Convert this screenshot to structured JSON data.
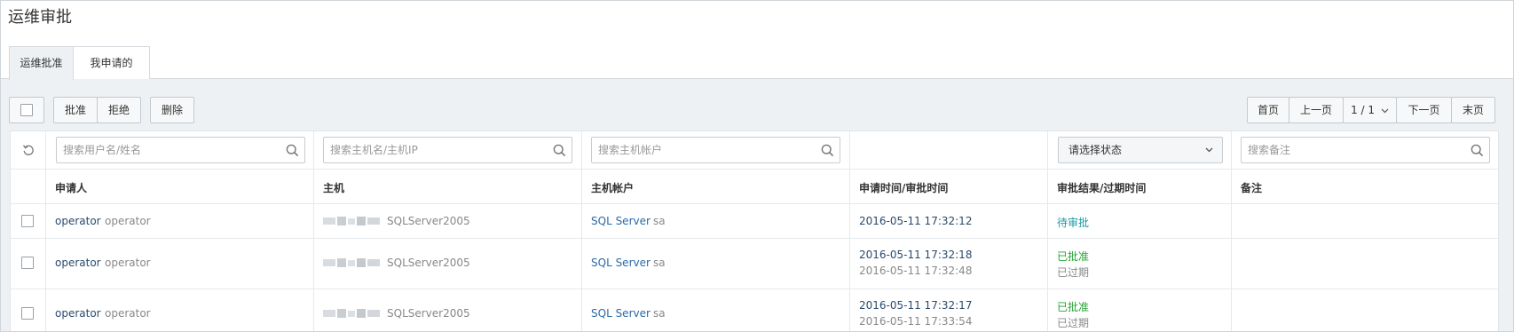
{
  "page": {
    "title": "运维审批"
  },
  "tabs": [
    {
      "label": "运维批准",
      "active": true
    },
    {
      "label": "我申请的",
      "active": false
    }
  ],
  "toolbar": {
    "approve_label": "批准",
    "reject_label": "拒绝",
    "delete_label": "删除"
  },
  "pagination": {
    "first_label": "首页",
    "prev_label": "上一页",
    "page_indicator": "1 / 1",
    "next_label": "下一页",
    "last_label": "末页"
  },
  "filters": {
    "user_placeholder": "搜索用户名/姓名",
    "host_placeholder": "搜索主机名/主机IP",
    "account_placeholder": "搜索主机帐户",
    "status_select": "请选择状态",
    "remark_placeholder": "搜索备注"
  },
  "columns": {
    "applicant": "申请人",
    "host": "主机",
    "account": "主机帐户",
    "time": "申请时间/审批时间",
    "result": "审批结果/过期时间",
    "remark": "备注"
  },
  "rows": [
    {
      "user": "operator",
      "name": "operator",
      "host": "SQLServer2005",
      "account_type": "SQL Server",
      "account": "sa",
      "apply_time": "2016-05-11 17:32:12",
      "approve_time": "",
      "status": "待审批",
      "expire": "",
      "remark": ""
    },
    {
      "user": "operator",
      "name": "operator",
      "host": "SQLServer2005",
      "account_type": "SQL Server",
      "account": "sa",
      "apply_time": "2016-05-11 17:32:18",
      "approve_time": "2016-05-11 17:32:48",
      "status": "已批准",
      "expire": "已过期",
      "remark": ""
    },
    {
      "user": "operator",
      "name": "operator",
      "host": "SQLServer2005",
      "account_type": "SQL Server",
      "account": "sa",
      "apply_time": "2016-05-11 17:32:17",
      "approve_time": "2016-05-11 17:33:54",
      "status": "已批准",
      "expire": "已过期",
      "remark": ""
    }
  ],
  "colors": {
    "pending": "#1a9aa6",
    "approved": "#25a332",
    "link": "#2a6aa8",
    "toolbar_bg": "#eef1f4"
  },
  "icons": {
    "refresh": "refresh-icon",
    "search": "search-icon",
    "dropdown": "chevron-down-icon"
  }
}
